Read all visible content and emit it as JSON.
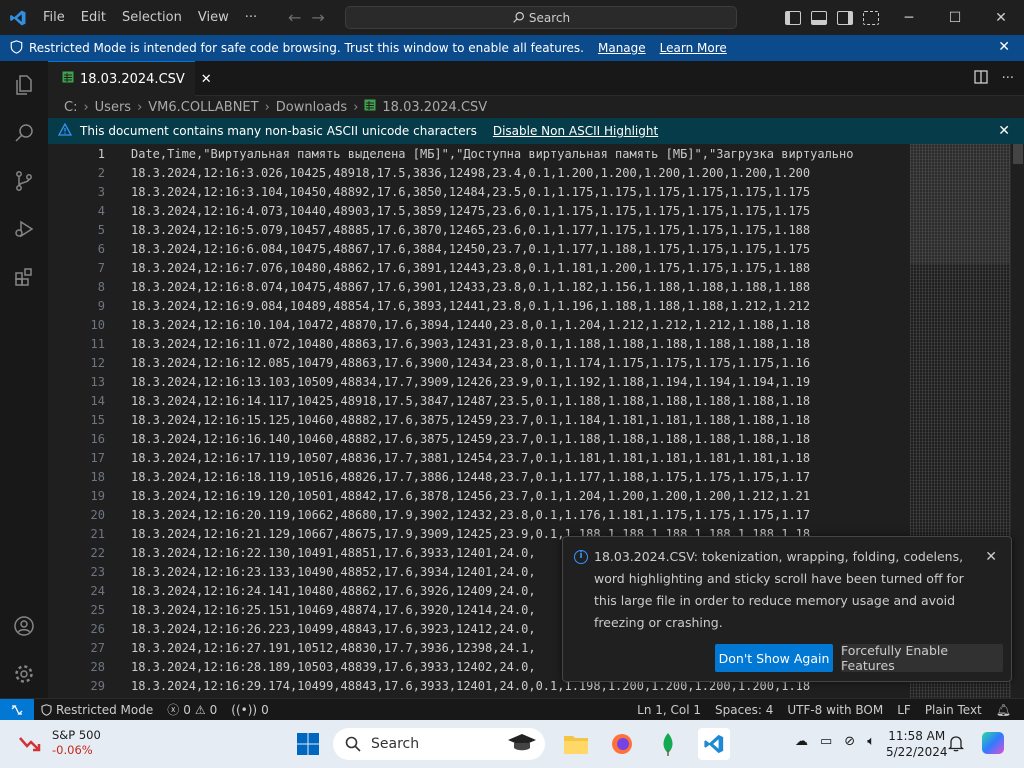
{
  "titlebar": {
    "menu": [
      "File",
      "Edit",
      "Selection",
      "View",
      "···"
    ],
    "search_label": "Search"
  },
  "restricted_banner": {
    "message": "Restricted Mode is intended for safe code browsing. Trust this window to enable all features.",
    "manage_label": "Manage",
    "learn_more_label": "Learn More"
  },
  "tab": {
    "label": "18.03.2024.CSV"
  },
  "breadcrumb": [
    "C:",
    "Users",
    "VM6.COLLABNET",
    "Downloads",
    "18.03.2024.CSV"
  ],
  "ascii_banner": {
    "message": "This document contains many non-basic ASCII unicode characters",
    "link_label": "Disable Non ASCII Highlight"
  },
  "editor": {
    "line_numbers": [
      "1",
      "2",
      "3",
      "4",
      "5",
      "6",
      "7",
      "8",
      "9",
      "10",
      "11",
      "12",
      "13",
      "14",
      "15",
      "16",
      "17",
      "18",
      "19",
      "20",
      "21",
      "22",
      "23",
      "24",
      "25",
      "26",
      "27",
      "28",
      "29"
    ],
    "lines": [
      "Date,Time,\"Виртуальная память выделена [МБ]\",\"Доступна виртуальная память [МБ]\",\"Загрузка виртуально",
      "18.3.2024,12:16:3.026,10425,48918,17.5,3836,12498,23.4,0.1,1.200,1.200,1.200,1.200,1.200,1.200",
      "18.3.2024,12:16:3.104,10450,48892,17.6,3850,12484,23.5,0.1,1.175,1.175,1.175,1.175,1.175,1.175",
      "18.3.2024,12:16:4.073,10440,48903,17.5,3859,12475,23.6,0.1,1.175,1.175,1.175,1.175,1.175,1.175",
      "18.3.2024,12:16:5.079,10457,48885,17.6,3870,12465,23.6,0.1,1.177,1.175,1.175,1.175,1.175,1.188",
      "18.3.2024,12:16:6.084,10475,48867,17.6,3884,12450,23.7,0.1,1.177,1.188,1.175,1.175,1.175,1.175",
      "18.3.2024,12:16:7.076,10480,48862,17.6,3891,12443,23.8,0.1,1.181,1.200,1.175,1.175,1.175,1.188",
      "18.3.2024,12:16:8.074,10475,48867,17.6,3901,12433,23.8,0.1,1.182,1.156,1.188,1.188,1.188,1.188",
      "18.3.2024,12:16:9.084,10489,48854,17.6,3893,12441,23.8,0.1,1.196,1.188,1.188,1.188,1.212,1.212",
      "18.3.2024,12:16:10.104,10472,48870,17.6,3894,12440,23.8,0.1,1.204,1.212,1.212,1.212,1.188,1.18",
      "18.3.2024,12:16:11.072,10480,48863,17.6,3903,12431,23.8,0.1,1.188,1.188,1.188,1.188,1.188,1.18",
      "18.3.2024,12:16:12.085,10479,48863,17.6,3900,12434,23.8,0.1,1.174,1.175,1.175,1.175,1.175,1.16",
      "18.3.2024,12:16:13.103,10509,48834,17.7,3909,12426,23.9,0.1,1.192,1.188,1.194,1.194,1.194,1.19",
      "18.3.2024,12:16:14.117,10425,48918,17.5,3847,12487,23.5,0.1,1.188,1.188,1.188,1.188,1.188,1.18",
      "18.3.2024,12:16:15.125,10460,48882,17.6,3875,12459,23.7,0.1,1.184,1.181,1.181,1.188,1.188,1.18",
      "18.3.2024,12:16:16.140,10460,48882,17.6,3875,12459,23.7,0.1,1.188,1.188,1.188,1.188,1.188,1.18",
      "18.3.2024,12:16:17.119,10507,48836,17.7,3881,12454,23.7,0.1,1.181,1.181,1.181,1.181,1.181,1.18",
      "18.3.2024,12:16:18.119,10516,48826,17.7,3886,12448,23.7,0.1,1.177,1.188,1.175,1.175,1.175,1.17",
      "18.3.2024,12:16:19.120,10501,48842,17.6,3878,12456,23.7,0.1,1.204,1.200,1.200,1.200,1.212,1.21",
      "18.3.2024,12:16:20.119,10662,48680,17.9,3902,12432,23.8,0.1,1.176,1.181,1.175,1.175,1.175,1.17",
      "18.3.2024,12:16:21.129,10667,48675,17.9,3909,12425,23.9,0.1,1.188,1.188,1.188,1.188,1.188,1.18",
      "18.3.2024,12:16:22.130,10491,48851,17.6,3933,12401,24.0,",
      "18.3.2024,12:16:23.133,10490,48852,17.6,3934,12401,24.0,",
      "18.3.2024,12:16:24.141,10480,48862,17.6,3926,12409,24.0,",
      "18.3.2024,12:16:25.151,10469,48874,17.6,3920,12414,24.0,",
      "18.3.2024,12:16:26.223,10499,48843,17.6,3923,12412,24.0,",
      "18.3.2024,12:16:27.191,10512,48830,17.7,3936,12398,24.1,",
      "18.3.2024,12:16:28.189,10503,48839,17.6,3933,12402,24.0,",
      "18.3.2024,12:16:29.174,10499,48843,17.6,3933,12401,24.0,0.1,1.198,1.200,1.200,1.200,1.200,1.18"
    ]
  },
  "notification": {
    "message": "18.03.2024.CSV: tokenization, wrapping, folding, codelens, word highlighting and sticky scroll have been turned off for this large file in order to reduce memory usage and avoid freezing or crashing.",
    "primary_label": "Don't Show Again",
    "secondary_label": "Forcefully Enable Features"
  },
  "statusbar": {
    "restricted_label": "Restricted Mode",
    "errors": "0",
    "warnings": "0",
    "ports": "0",
    "cursor": "Ln 1, Col 1",
    "spaces": "Spaces: 4",
    "encoding": "UTF-8 with BOM",
    "eol": "LF",
    "language": "Plain Text"
  },
  "taskbar": {
    "stock_name": "S&P 500",
    "stock_change": "-0.06%",
    "search_label": "Search",
    "time": "11:58 AM",
    "date": "5/22/2024"
  },
  "colors": {
    "accent": "#0078d4",
    "restricted_banner": "#0b4a8b",
    "ascii_banner": "#063b49",
    "stock_down": "#c42b1c"
  }
}
